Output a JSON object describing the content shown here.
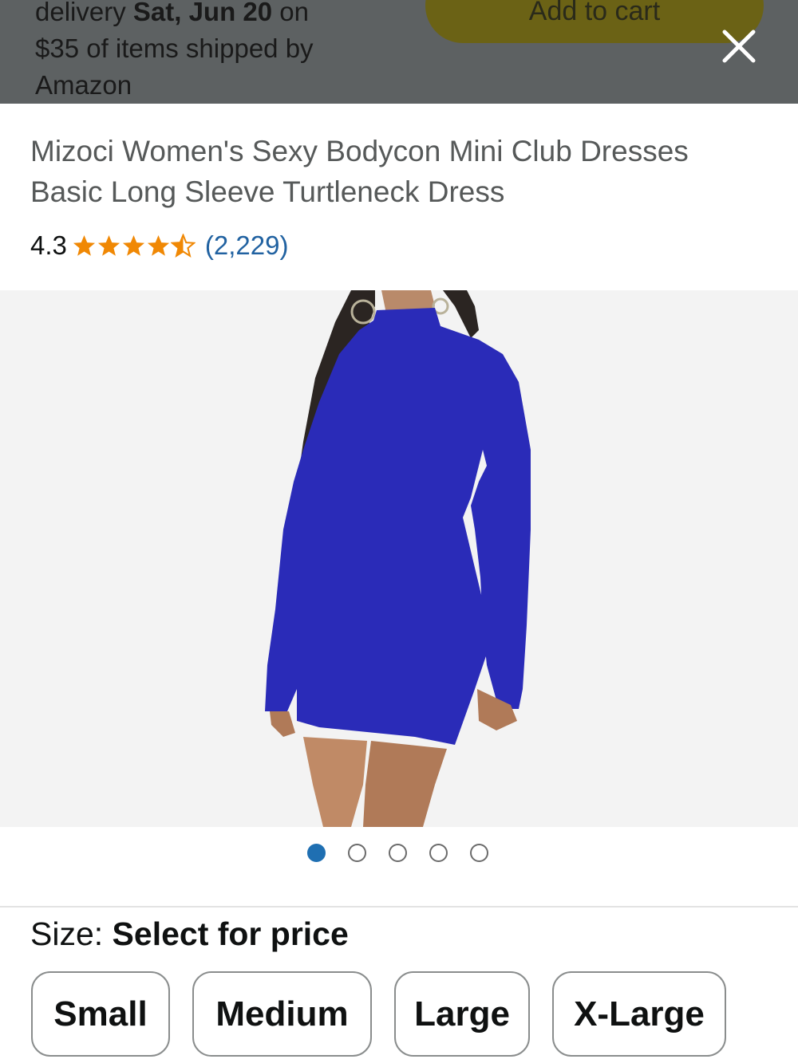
{
  "overlay": {
    "delivery_prefix": "delivery ",
    "delivery_date": "Sat, Jun 20",
    "delivery_suffix": " on",
    "delivery_line2": "$35 of items shipped by",
    "delivery_line3": "Amazon",
    "add_to_cart_label": "Add to cart",
    "close_icon": "close-icon"
  },
  "product": {
    "title": "Mizoci Women's Sexy Bodycon Mini Club Dresses Basic Long Sleeve Turtleneck Dress",
    "rating": "4.3",
    "stars": 4.3,
    "review_count": "(2,229)",
    "dress_color": "#2a2bb8"
  },
  "carousel": {
    "total": 5,
    "active_index": 0
  },
  "size": {
    "label": "Size: ",
    "prompt": "Select for price",
    "options": [
      "Small",
      "Medium",
      "Large",
      "X-Large"
    ]
  },
  "colors": {
    "star": "#f08804",
    "link": "#2162a1",
    "active_dot": "#1f6fb2"
  }
}
